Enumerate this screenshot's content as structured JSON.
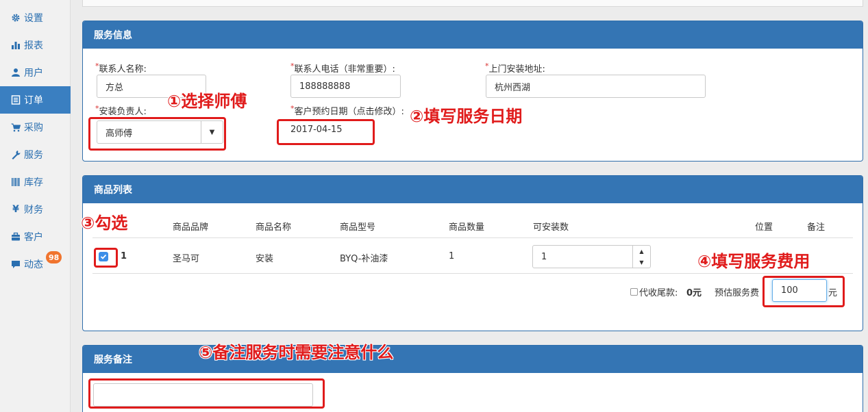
{
  "sidebar": {
    "items": [
      {
        "label": "设置",
        "icon": "gear-icon"
      },
      {
        "label": "报表",
        "icon": "bar-chart-icon"
      },
      {
        "label": "用户",
        "icon": "user-icon"
      },
      {
        "label": "订单",
        "icon": "list-icon",
        "active": true
      },
      {
        "label": "采购",
        "icon": "cart-icon"
      },
      {
        "label": "服务",
        "icon": "wrench-icon"
      },
      {
        "label": "库存",
        "icon": "barcode-icon"
      },
      {
        "label": "财务",
        "icon": "yen-icon"
      },
      {
        "label": "客户",
        "icon": "briefcase-icon"
      },
      {
        "label": "动态",
        "icon": "comment-icon",
        "badge": "98"
      }
    ]
  },
  "service_info": {
    "title": "服务信息",
    "contact_name_label": "联系人名称:",
    "contact_name_value": "方总",
    "contact_phone_label": "联系人电话（非常重要）:",
    "contact_phone_value": "188888888",
    "address_label": "上门安装地址:",
    "address_value": "杭州西湖",
    "installer_label": "安装负责人:",
    "installer_value": "高师傅",
    "appointment_label": "客户预约日期（点击修改）:",
    "appointment_value": "2017-04-15",
    "required_mark": "*"
  },
  "product_list": {
    "title": "商品列表",
    "columns": [
      "商品品牌",
      "商品名称",
      "商品型号",
      "商品数量",
      "可安装数",
      "位置",
      "备注"
    ],
    "rows": [
      {
        "index": "1",
        "brand": "圣马可",
        "name": "安装",
        "model": "BYQ-补油漆",
        "quantity": "1",
        "installable": "1"
      }
    ],
    "collect_label": "代收尾款:",
    "collect_value": "0元",
    "fee_label": "预估服务费",
    "fee_value": "100",
    "fee_unit": "元"
  },
  "service_note": {
    "title": "服务备注",
    "value": ""
  },
  "annotations": {
    "step1": "①选择师傅",
    "step2": "②填写服务日期",
    "step3": "③勾选",
    "step4": "④填写服务费用",
    "step5": "⑤备注服务时需要注意什么"
  },
  "colors": {
    "primary": "#3475b4",
    "annotation": "#e01b1b",
    "badge": "#f0742e"
  }
}
